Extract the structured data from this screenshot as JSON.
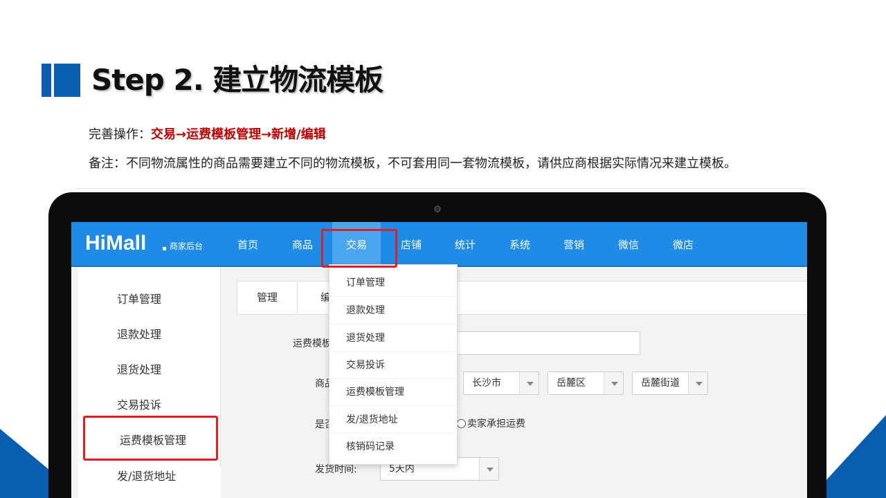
{
  "slide": {
    "title": "Step 2. 建立物流模板",
    "operation_prefix": "完善操作：",
    "operation_path": "交易→运费模板管理→新增/编辑",
    "note": "备注：不同物流属性的商品需要建立不同的物流模板，不可套用同一套物流模板，请供应商根据实际情况来建立模板。"
  },
  "app": {
    "logo": "HiMall",
    "logo_sub": "商家后台",
    "nav": [
      "首页",
      "商品",
      "交易",
      "店铺",
      "统计",
      "系统",
      "营销",
      "微信",
      "微店"
    ],
    "active_nav": "交易"
  },
  "sidebar": {
    "items": [
      "订单管理",
      "退款处理",
      "退货处理",
      "交易投诉",
      "运费模板管理",
      "发/退货地址"
    ],
    "active_item": "运费模板管理"
  },
  "tabs": [
    "管理",
    "编"
  ],
  "dropdown": {
    "items": [
      "订单管理",
      "退款处理",
      "退货处理",
      "交易投诉",
      "运费模板管理",
      "发/退货地址",
      "核销码记录"
    ]
  },
  "form": {
    "template_name_label": "运费模板",
    "origin_label": "商品",
    "city_value": "长沙市",
    "district_value": "岳麓区",
    "street_value": "岳麓街道",
    "free_label": "是否",
    "seller_pays_label": "卖家承担运费",
    "ship_time_label": "发货时间:",
    "ship_time_value": "5天内"
  },
  "colors": {
    "brand_blue": "#1e8ce6",
    "slide_blue": "#0a5eb0",
    "highlight_red": "#c00000",
    "annotation_red": "#e02020"
  }
}
